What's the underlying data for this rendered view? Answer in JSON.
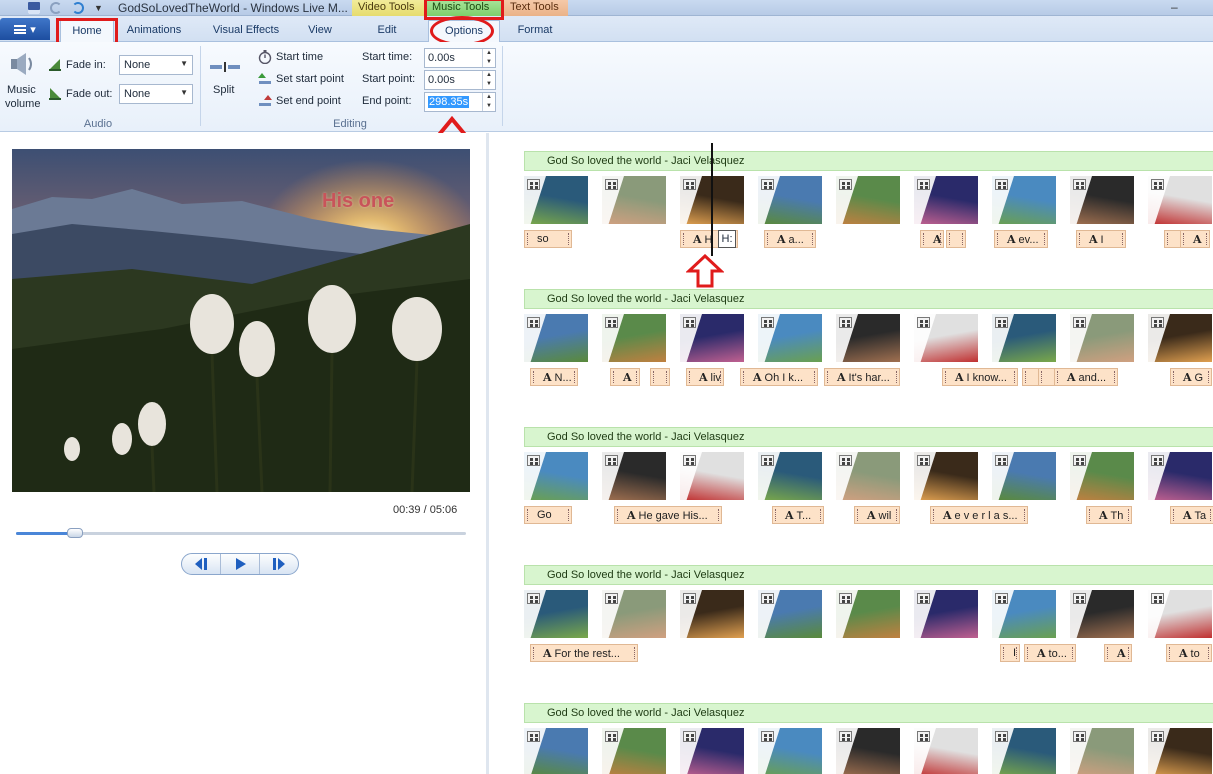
{
  "window": {
    "title": "GodSoLovedTheWorld - Windows Live M...",
    "context_tabs": {
      "video": "Video Tools",
      "music": "Music Tools",
      "text": "Text Tools"
    }
  },
  "tabs": [
    {
      "label": "Home"
    },
    {
      "label": "Animations"
    },
    {
      "label": "Visual Effects"
    },
    {
      "label": "View"
    },
    {
      "label": "Edit"
    },
    {
      "label": "Options"
    },
    {
      "label": "Format"
    }
  ],
  "ribbon": {
    "audio": {
      "music_volume_line1": "Music",
      "music_volume_line2": "volume",
      "fade_in_label": "Fade in:",
      "fade_in_value": "None",
      "fade_out_label": "Fade out:",
      "fade_out_value": "None",
      "group_label": "Audio"
    },
    "editing": {
      "split_label": "Split",
      "start_time_btn": "Start time",
      "set_start_btn": "Set start point",
      "set_end_btn": "Set end point",
      "start_time_label": "Start time:",
      "start_time_value": "0.00s",
      "start_point_label": "Start point:",
      "start_point_value": "0.00s",
      "end_point_label": "End point:",
      "end_point_value": "298.35s",
      "group_label": "Editing"
    }
  },
  "preview": {
    "overlay_text": "His one",
    "time": "00:39 / 05:06",
    "progress_fraction": 0.13
  },
  "colors": {
    "highlight": "#e01b1b",
    "music_bar": "#d8f5cf",
    "caption": "#fde2c8",
    "accent": "#4a86d8"
  },
  "storyboard": {
    "rows": [
      {
        "music_label": "God So loved the world - Jaci Velasquez",
        "captions": [
          {
            "a": false,
            "text": "so"
          },
          {
            "a": true,
            "text": "H"
          },
          {
            "a": true,
            "text": "a..."
          },
          {
            "a": true,
            "text": ""
          },
          {
            "a": false,
            "text": ""
          },
          {
            "a": true,
            "text": "ev..."
          },
          {
            "a": true,
            "text": "I"
          },
          {
            "a": false,
            "text": ""
          },
          {
            "a": true,
            "text": ""
          }
        ]
      },
      {
        "music_label": "God So loved the world - Jaci Velasquez",
        "captions": [
          {
            "a": true,
            "text": "N..."
          },
          {
            "a": true,
            "text": ""
          },
          {
            "a": false,
            "text": ""
          },
          {
            "a": true,
            "text": "liv"
          },
          {
            "a": true,
            "text": "Oh I k..."
          },
          {
            "a": true,
            "text": "It's har..."
          },
          {
            "a": true,
            "text": "I know..."
          },
          {
            "a": false,
            "text": ""
          },
          {
            "a": false,
            "text": ""
          },
          {
            "a": true,
            "text": "and..."
          },
          {
            "a": true,
            "text": "G"
          }
        ]
      },
      {
        "music_label": "God So loved the world - Jaci Velasquez",
        "captions": [
          {
            "a": false,
            "text": "Go"
          },
          {
            "a": true,
            "text": "He gave His..."
          },
          {
            "a": true,
            "text": "T..."
          },
          {
            "a": true,
            "text": "wil"
          },
          {
            "a": true,
            "text": "e v e r l a s..."
          },
          {
            "a": true,
            "text": "Th"
          },
          {
            "a": true,
            "text": "Ta"
          }
        ]
      },
      {
        "music_label": "God So loved the world - Jaci Velasquez",
        "captions": [
          {
            "a": true,
            "text": "For the rest..."
          },
          {
            "a": false,
            "text": "I"
          },
          {
            "a": true,
            "text": "to..."
          },
          {
            "a": true,
            "text": ""
          },
          {
            "a": true,
            "text": "to"
          }
        ]
      },
      {
        "music_label": "God So loved the world - Jaci Velasquez",
        "captions": []
      }
    ],
    "tooltip": "H:"
  }
}
